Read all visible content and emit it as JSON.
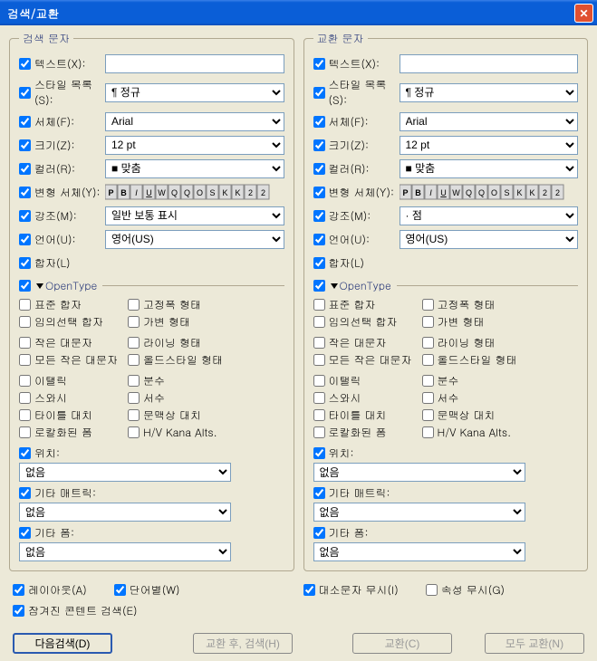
{
  "window": {
    "title": "검색/교환"
  },
  "panels": {
    "search": {
      "legend": "검색 문자"
    },
    "replace": {
      "legend": "교환 문자"
    }
  },
  "labels": {
    "text": "텍스트(X):",
    "styleList": "스타일 목록(S):",
    "font": "서체(F):",
    "size": "크기(Z):",
    "color": "컬러(R):",
    "typeface": "변형 서체(Y):",
    "emphasis": "강조(M):",
    "language": "언어(U):",
    "ligatures": "합자(L)"
  },
  "values": {
    "styleList": "¶ 정규",
    "font": "Arial",
    "size": "12 pt",
    "color": "맞춤",
    "emphasisSearch": "일반 보통 표시",
    "emphasisReplace": "· 점",
    "language": "영어(US)"
  },
  "opentype": {
    "header": "OpenType",
    "items": {
      "standardLigatures": "표준 합자",
      "discretionaryLigatures": "임의선택 합자",
      "tabularFigures": "고정폭 형태",
      "proportionalFigures": "가변 형태",
      "smallCaps": "작은 대문자",
      "allSmallCaps": "모든 작은 대문자",
      "liningFigures": "라이닝 형태",
      "oldstyleFigures": "올드스타일 형태",
      "italic": "이탤릭",
      "swash": "스와시",
      "titlingAlts": "타이틀 대치",
      "localizedForms": "로칼화된 폼",
      "fractions": "분수",
      "ordinals": "서수",
      "contextualAlts": "문맥상 대치",
      "hvKana": "H/V Kana Alts."
    },
    "position": "위치:",
    "otherMetrics": "기타 매트릭:",
    "otherForm": "기타 폼:",
    "none": "없음"
  },
  "options": {
    "layout": "레이아웃(A)",
    "wordOnly": "단어별(W)",
    "hiddenContent": "잠겨진 콘텐트 검색(E)",
    "ignoreCase": "대소문자 무시(I)",
    "ignoreAttrs": "속성 무시(G)"
  },
  "buttons": {
    "findNext": "다음검색(D)",
    "replaceFind": "교환 후, 검색(H)",
    "replace": "교환(C)",
    "replaceAll": "모두 교환(N)"
  }
}
